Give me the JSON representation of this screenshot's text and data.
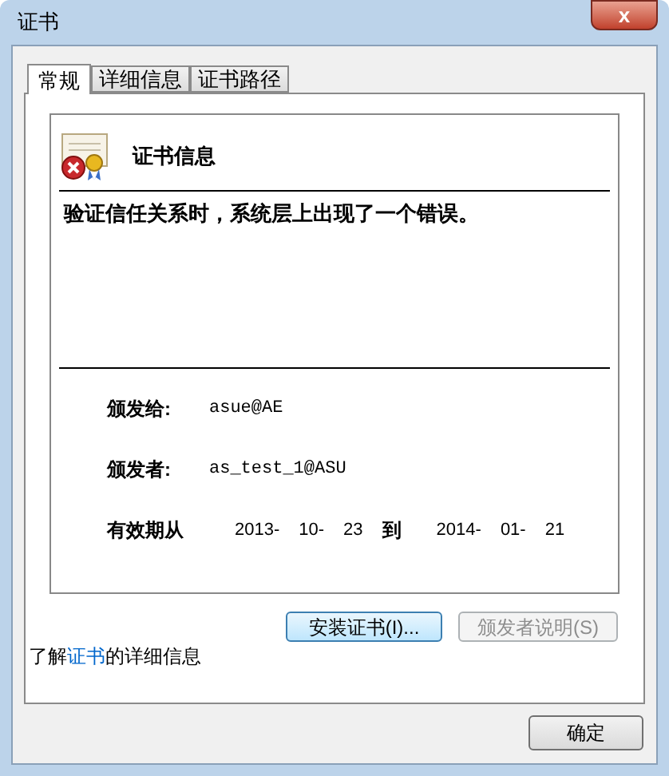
{
  "window": {
    "title": "证书",
    "close": "x"
  },
  "tabs": [
    {
      "label": "常规",
      "selected": true
    },
    {
      "label": "详细信息",
      "selected": false
    },
    {
      "label": "证书路径",
      "selected": false
    }
  ],
  "certificate": {
    "heading": "证书信息",
    "message": "验证信任关系时，系统层上出现了一个错误。",
    "fields": [
      {
        "label": "颁发给:",
        "value": "asue@AE"
      },
      {
        "label": "颁发者:",
        "value": "as_test_1@ASU"
      }
    ],
    "validity": {
      "label": "有效期从",
      "from": [
        "2013-",
        "10-",
        "23"
      ],
      "to_label": "到",
      "to": [
        "2014-",
        "01-",
        "21"
      ]
    }
  },
  "buttons": [
    {
      "label": "安装证书(I)...",
      "disabled": false
    },
    {
      "label": "颁发者说明(S)",
      "disabled": true
    }
  ],
  "info": {
    "before": "了解",
    "link": "证书",
    "after": "的详细信息"
  },
  "ok_button": "确定"
}
